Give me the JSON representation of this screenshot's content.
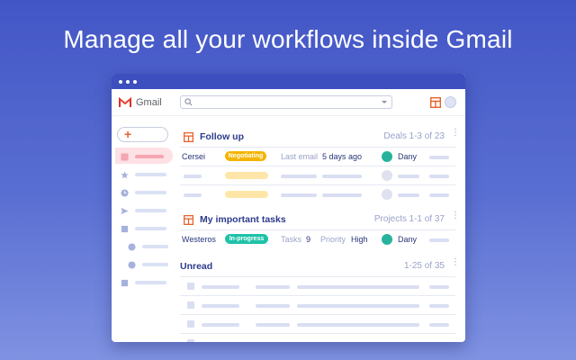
{
  "headline": "Manage all your workflows inside Gmail",
  "gmail": {
    "app_name": "Gmail"
  },
  "follow_up": {
    "title": "Follow up",
    "kind": "Deals",
    "count": "1-3 of 23",
    "row1": {
      "name": "Cersei",
      "badge": "Negotiating",
      "label": "Last email",
      "value": "5 days ago",
      "user": "Dany"
    }
  },
  "tasks": {
    "title": "My important tasks",
    "kind": "Projects",
    "count": "1-1 of 37",
    "row1": {
      "name": "Westeros",
      "badge": "In-progress",
      "tasks_label": "Tasks",
      "tasks_value": "9",
      "priority_label": "Priority",
      "priority_value": "High",
      "user": "Dany"
    }
  },
  "unread": {
    "title": "Unread",
    "count": "1-25 of 35"
  },
  "colors": {
    "background": "#4356c6",
    "titlebar": "#3d4fbf",
    "negotiating": "#f4b400",
    "in_progress": "#1ec2a8",
    "avatar_teal": "#27b39b",
    "section_icon": "#e8622c"
  }
}
